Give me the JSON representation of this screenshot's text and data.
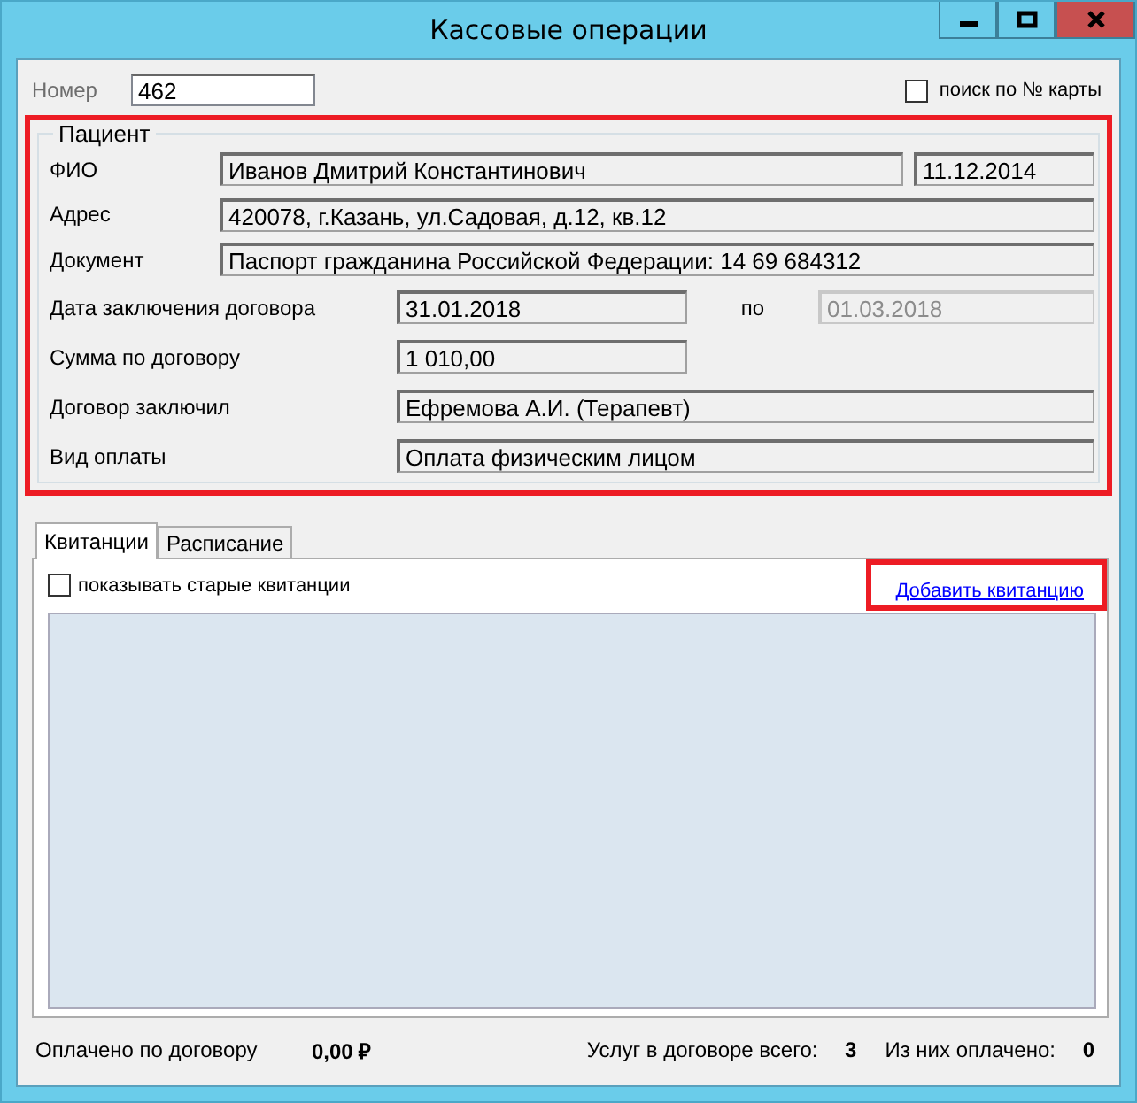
{
  "window": {
    "title": "Кассовые операции",
    "controls": [
      {
        "kind": "minimize"
      },
      {
        "kind": "maximize"
      },
      {
        "kind": "close"
      }
    ]
  },
  "number": {
    "label": "Номер",
    "value": "462"
  },
  "card_search": {
    "label": "поиск по № карты",
    "checked": false
  },
  "patient": {
    "title": "Пациент",
    "rows": [
      {
        "label": "ФИО",
        "kind": "wide",
        "value": "Иванов Дмитрий Константинович",
        "disabled": false,
        "extra": {
          "value": "11.12.2014",
          "disabled": false
        }
      },
      {
        "label": "Адрес",
        "kind": "wide",
        "value": "420078, г.Казань, ул.Садовая, д.12, кв.12",
        "disabled": false
      },
      {
        "label": "Документ",
        "kind": "wide",
        "value": "Паспорт гражданина Российской Федерации: 14 69 684312",
        "disabled": false
      },
      {
        "label": "Дата заключения договора",
        "kind": "short",
        "value": "31.01.2018",
        "disabled": false,
        "to": {
          "label": "по",
          "value": "01.03.2018",
          "disabled": true
        }
      },
      {
        "label": "Сумма по договору",
        "kind": "short",
        "value": "1 010,00",
        "disabled": false
      },
      {
        "label": "Договор заключил",
        "kind": "long",
        "value": "Ефремова А.И. (Терапевт)",
        "disabled": false
      },
      {
        "label": "Вид оплаты",
        "kind": "long",
        "value": "Оплата физическим лицом",
        "disabled": false
      }
    ]
  },
  "tabs": [
    {
      "label": "Квитанции",
      "selected": true
    },
    {
      "label": "Расписание",
      "selected": false
    }
  ],
  "show_old": {
    "label": "показывать старые квитанции",
    "checked": false
  },
  "add_link": "Добавить квитанцию",
  "footer": {
    "paid_label": "Оплачено по договору",
    "paid_value": "0,00 ₽",
    "services_label": "Услуг в договоре всего:",
    "services_value": "3",
    "paid_count_label": "Из них оплачено:",
    "paid_count_value": "0"
  }
}
